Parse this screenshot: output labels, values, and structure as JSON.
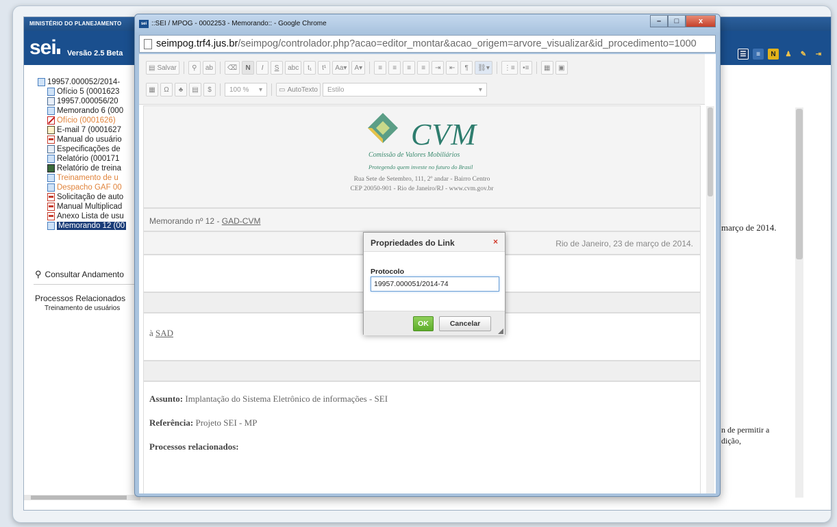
{
  "sei": {
    "ministry": "MINISTÉRIO DO PLANEJAMENTO",
    "logo": "sei",
    "version": "Versão 2.5 Beta"
  },
  "tree": {
    "items": [
      {
        "label": "19957.000052/2014-",
        "type": "process"
      },
      {
        "label": "Ofício 5 (0001623",
        "type": "doc"
      },
      {
        "label": "19957.000056/20",
        "type": "sheet"
      },
      {
        "label": "Memorando 6 (000",
        "type": "doc"
      },
      {
        "label": "Ofício (0001626)",
        "type": "cancelled"
      },
      {
        "label": "E-mail 7 (0001627",
        "type": "mail"
      },
      {
        "label": "Manual do usuário",
        "type": "pdf"
      },
      {
        "label": "Especificações de",
        "type": "sheet"
      },
      {
        "label": "Relatório (000171",
        "type": "doc"
      },
      {
        "label": "Relatório de treina",
        "type": "ppt"
      },
      {
        "label": "Treinamento de u",
        "type": "doc-orange"
      },
      {
        "label": "Despacho GAF 00",
        "type": "doc-orange"
      },
      {
        "label": "Solicitação de auto",
        "type": "pdf"
      },
      {
        "label": "Manual Multiplicad",
        "type": "pdf"
      },
      {
        "label": "Anexo Lista de usu",
        "type": "pdf"
      },
      {
        "label": "Memorando 12 (00",
        "type": "selected"
      }
    ],
    "consult": "Consultar Andamento",
    "related_title": "Processos Relacionados",
    "related_item": "Treinamento de usuários"
  },
  "background": {
    "date_fragment": "março de 2014.",
    "text_fragment1": "n de permitir a",
    "text_fragment2": "dição,"
  },
  "chrome": {
    "title": "::SEI / MPOG - 0002253 - Memorando:: - Google Chrome",
    "favicon": "sei",
    "url_host": "seimpog.trf4.jus.br",
    "url_path": "/seimpog/controlador.php?acao=editor_montar&acao_origem=arvore_visualizar&id_procedimento=1000",
    "minimize": "–",
    "maximize": "□",
    "close": "x"
  },
  "toolbar": {
    "save": "Salvar",
    "zoom": "100 %",
    "autotext": "AutoTexto",
    "style": "Estilo",
    "bold": "N",
    "italic": "I",
    "underline": "S"
  },
  "document": {
    "cvm_letters": "CVM",
    "cvm_name": "Comissão de Valores Mobiliários",
    "cvm_slogan": "Protegendo quem investe no futuro do Brasil",
    "address1": "Rua Sete de Setembro, 111, 2º andar - Bairro Centro",
    "address2": "CEP 20050-901 - Rio de Janeiro/RJ - www.cvm.gov.br",
    "memo_prefix": "Memorando nº 12 - ",
    "memo_unit": "GAD-CVM",
    "date": "Rio de Janeiro, 23 de março de 2014.",
    "destination_prefix": "à ",
    "destination": "SAD",
    "subject_label": "Assunto:",
    "subject": "Implantação do Sistema Eletrônico de informações - SEI",
    "reference_label": "Referência:",
    "reference": "Projeto SEI - MP",
    "related_label": "Processos relacionados:"
  },
  "dialog": {
    "title": "Propriedades do Link",
    "close": "×",
    "field_label": "Protocolo",
    "field_value": "19957.000051/2014-74",
    "ok": "OK",
    "cancel": "Cancelar"
  },
  "colors": {
    "sei_blue": "#1a4f8e",
    "ok_green": "#5cad2a",
    "selected_bg": "#1a3c78",
    "cvm_green": "#2e7d6e"
  }
}
